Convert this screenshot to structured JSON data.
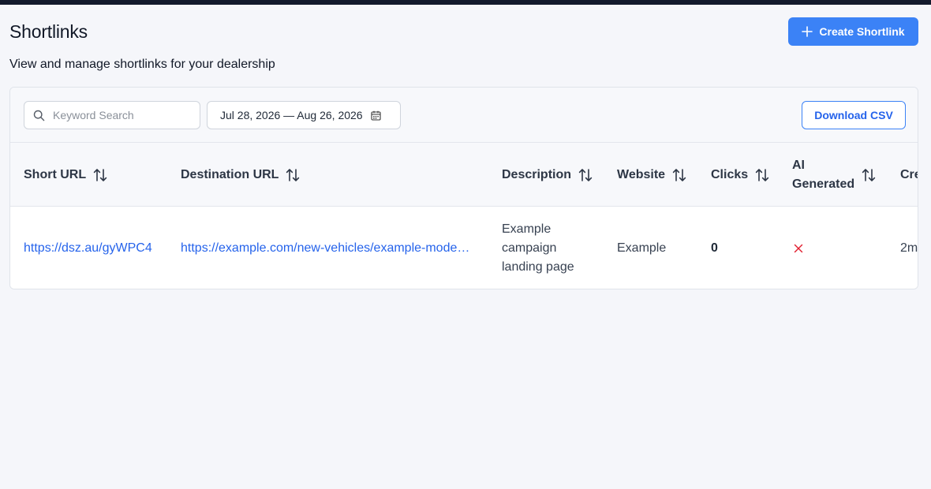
{
  "header": {
    "title": "Shortlinks",
    "subtitle": "View and manage shortlinks for your dealership",
    "create_button_label": "Create Shortlink"
  },
  "toolbar": {
    "search": {
      "placeholder": "Keyword Search",
      "value": ""
    },
    "date_range": "Jul 28, 2026 — Aug 26, 2026",
    "download_label": "Download CSV"
  },
  "table": {
    "columns": [
      {
        "label": "Short URL"
      },
      {
        "label": "Destination URL"
      },
      {
        "label": "Description"
      },
      {
        "label": "Website"
      },
      {
        "label": "Clicks"
      },
      {
        "label_line1": "AI",
        "label_line2": "Generated"
      },
      {
        "label": "Cre"
      }
    ],
    "rows": [
      {
        "short_url": "https://dsz.au/gyWPC4",
        "destination_url": "https://example.com/new-vehicles/example-mode…",
        "description": "Example campaign landing page",
        "website": "Example",
        "clicks": "0",
        "ai_generated": "✕",
        "created": "2m"
      }
    ]
  },
  "colors": {
    "accent": "#3b82f6",
    "link": "#2563eb",
    "negative": "#e11d2e",
    "topbar": "#131a2c"
  },
  "icons": {
    "create": "plus-icon",
    "search": "search-icon",
    "date": "calendar-icon",
    "sort": "sort-icon",
    "ai_false": "x-icon"
  }
}
